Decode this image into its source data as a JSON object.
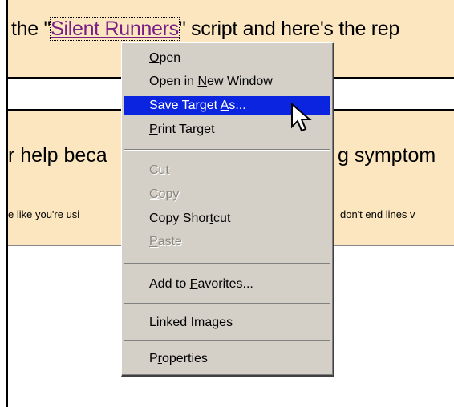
{
  "page": {
    "line1_before": "the \"",
    "line1_link": "Silent Runners",
    "line1_after": "\" script and here's the rep",
    "line2_left": "r help beca",
    "line2_right": "g symptom",
    "line3_left": "e like you're usi",
    "line3_right": "don't end lines v"
  },
  "menu": {
    "items": [
      {
        "label": "Open",
        "hotkey": "O",
        "rest": "pen"
      },
      {
        "label": "Open in New Window",
        "pre": "Open in ",
        "hotkey": "N",
        "rest": "ew Window"
      },
      {
        "label": "Save Target As...",
        "pre": "Save Target ",
        "hotkey": "A",
        "rest": "s..."
      },
      {
        "label": "Print Target",
        "hotkey": "P",
        "rest": "rint Target"
      },
      {
        "label": "Cut"
      },
      {
        "label": "Copy",
        "hotkey": "C",
        "rest": "opy"
      },
      {
        "label": "Copy Shortcut",
        "pre": "Copy Shor",
        "hotkey": "t",
        "rest": "cut"
      },
      {
        "label": "Paste",
        "hotkey": "P",
        "rest": "aste"
      },
      {
        "label": "Add to Favorites...",
        "pre": "Add to ",
        "hotkey": "F",
        "rest": "avorites..."
      },
      {
        "label": "Linked Images"
      },
      {
        "label": "Properties",
        "pre": "P",
        "hotkey": "r",
        "rest": "operties"
      }
    ],
    "selected": "Save Target As...",
    "disabled": [
      "Cut",
      "Copy",
      "Paste"
    ]
  },
  "colors": {
    "band": "#fbe6c0",
    "link": "#7a1e84",
    "menu_bg": "#d4d0c8",
    "highlight": "#0a24e0"
  }
}
